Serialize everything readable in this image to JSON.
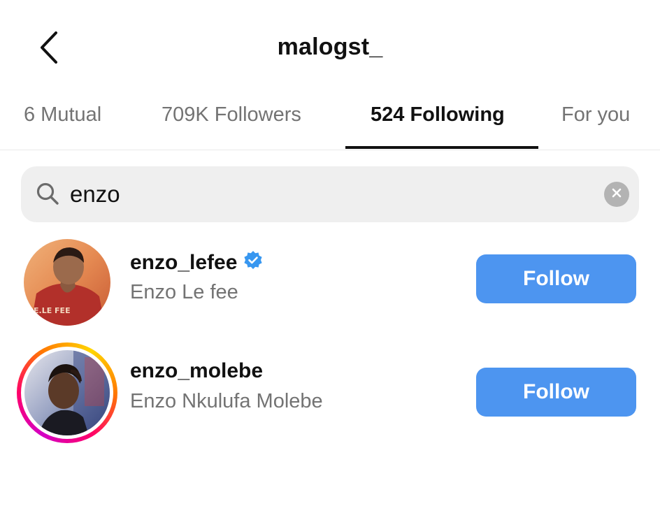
{
  "header": {
    "title": "malogst_",
    "back_icon": "chevron-left-icon"
  },
  "tabs": [
    {
      "label": "6 Mutual",
      "active": false
    },
    {
      "label": "709K Followers",
      "active": false
    },
    {
      "label": "524 Following",
      "active": true
    },
    {
      "label": "For you",
      "active": false
    }
  ],
  "search": {
    "value": "enzo",
    "placeholder": "Search",
    "icon": "search-icon",
    "clear_icon": "clear-icon"
  },
  "results": [
    {
      "username": "enzo_lefee",
      "full_name": "Enzo Le fee",
      "verified": true,
      "has_story": false,
      "jersey_text": "E.LE FEE",
      "follow_label": "Follow"
    },
    {
      "username": "enzo_molebe",
      "full_name": "Enzo Nkulufa Molebe",
      "verified": false,
      "has_story": true,
      "follow_label": "Follow"
    }
  ],
  "colors": {
    "follow_button": "#4d95f0",
    "verified_badge": "#3897f0",
    "secondary_text": "#737373",
    "search_background": "#efefef"
  }
}
